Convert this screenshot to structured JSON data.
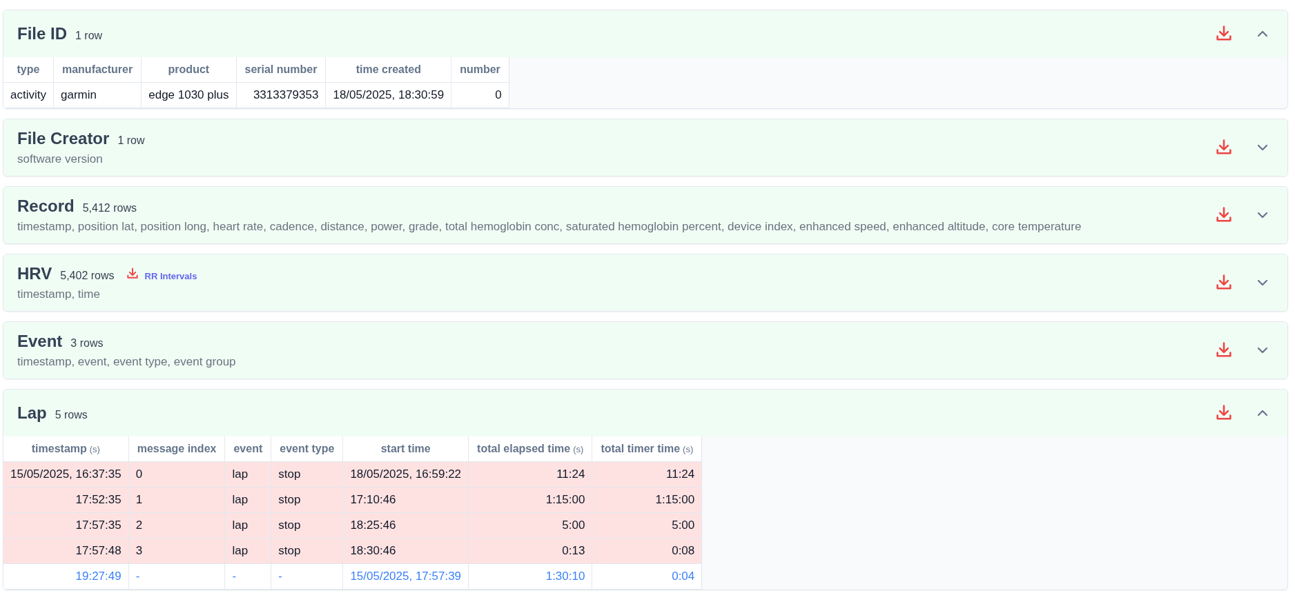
{
  "sections": [
    {
      "title": "File ID",
      "count": "1 row",
      "expanded": true,
      "table": {
        "columns": [
          {
            "label": "type",
            "kind": "text"
          },
          {
            "label": "manufacturer",
            "kind": "text"
          },
          {
            "label": "product",
            "kind": "text"
          },
          {
            "label": "serial number",
            "kind": "number"
          },
          {
            "label": "time created",
            "kind": "text"
          },
          {
            "label": "number",
            "kind": "number"
          }
        ],
        "rows": [
          {
            "kind": "data",
            "cells": [
              "activity",
              "garmin",
              "edge 1030 plus",
              "3313379353",
              "18/05/2025, 18:30:59",
              "0"
            ]
          }
        ]
      }
    },
    {
      "title": "File Creator",
      "count": "1 row",
      "expanded": false,
      "fields": "software version"
    },
    {
      "title": "Record",
      "count": "5,412 rows",
      "expanded": false,
      "fields": "timestamp, position lat, position long, heart rate, cadence, distance, power, grade, total hemoglobin conc, saturated hemoglobin percent, device index, enhanced speed, enhanced altitude, core temperature"
    },
    {
      "title": "HRV",
      "count": "5,402 rows",
      "expanded": false,
      "link": "RR Intervals",
      "fields": "timestamp, time"
    },
    {
      "title": "Event",
      "count": "3 rows",
      "expanded": false,
      "fields": "timestamp, event, event type, event group"
    },
    {
      "title": "Lap",
      "count": "5 rows",
      "expanded": true,
      "table": {
        "columns": [
          {
            "label": "timestamp",
            "unit": "(s)",
            "kind": "number"
          },
          {
            "label": "message index",
            "kind": "text"
          },
          {
            "label": "event",
            "kind": "text"
          },
          {
            "label": "event type",
            "kind": "text"
          },
          {
            "label": "start time",
            "kind": "text"
          },
          {
            "label": "total elapsed time",
            "unit": "(s)",
            "kind": "number"
          },
          {
            "label": "total timer time",
            "unit": "(s)",
            "kind": "number"
          }
        ],
        "rows": [
          {
            "kind": "lap",
            "cells": [
              "15/05/2025, 16:37:35",
              "0",
              "lap",
              "stop",
              "18/05/2025, 16:59:22",
              "11:24",
              "11:24"
            ]
          },
          {
            "kind": "lap",
            "cells": [
              "17:52:35",
              "1",
              "lap",
              "stop",
              "17:10:46",
              "1:15:00",
              "1:15:00"
            ]
          },
          {
            "kind": "lap",
            "cells": [
              "17:57:35",
              "2",
              "lap",
              "stop",
              "18:25:46",
              "5:00",
              "5:00"
            ]
          },
          {
            "kind": "lap",
            "cells": [
              "17:57:48",
              "3",
              "lap",
              "stop",
              "18:30:46",
              "0:13",
              "0:08"
            ]
          },
          {
            "kind": "total",
            "cells": [
              "19:27:49",
              "-",
              "-",
              "-",
              "15/05/2025, 17:57:39",
              "1:30:10",
              "0:04"
            ]
          }
        ]
      }
    }
  ]
}
